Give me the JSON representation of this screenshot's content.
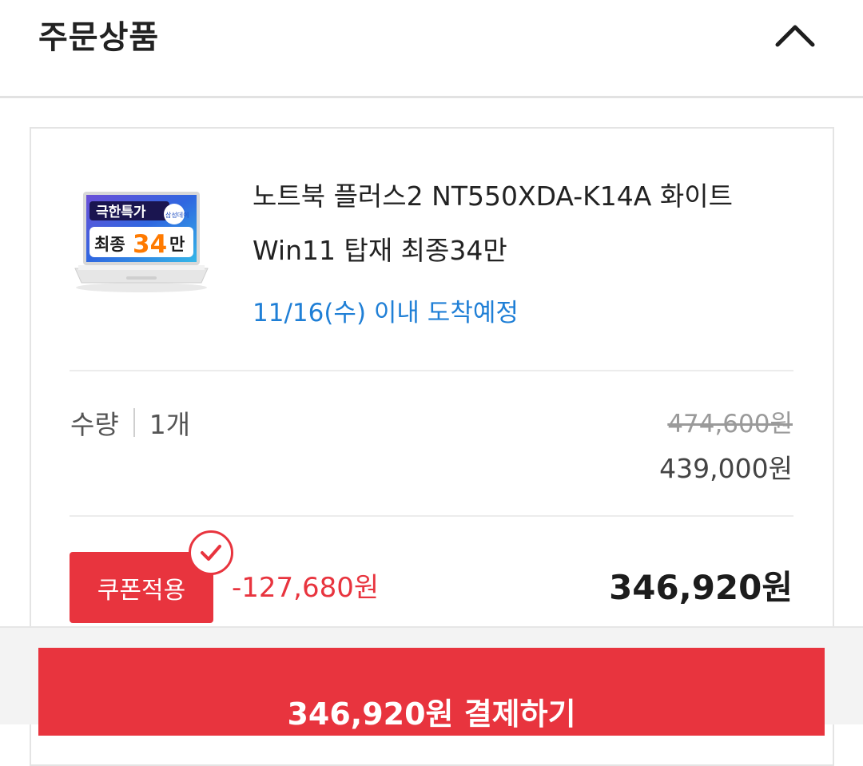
{
  "header": {
    "title": "주문상품"
  },
  "product": {
    "thumbnail_lines": [
      "극한특가",
      "삼성데이",
      "최종",
      "34",
      "만"
    ],
    "name": "노트북 플러스2 NT550XDA-K14A 화이트 Win11 탑재 최종34만",
    "delivery": "11/16(수) 이내 도착예정"
  },
  "quantity": {
    "label": "수량",
    "value": "1개"
  },
  "price": {
    "original": "474,600원",
    "sale": "439,000원"
  },
  "coupon": {
    "label": "쿠폰적용",
    "discount": "-127,680원"
  },
  "total": {
    "final_price": "346,920원"
  },
  "pay_button": {
    "label": "346,920원 결제하기"
  },
  "colors": {
    "accent_red": "#e8343e",
    "link_blue": "#1f7fd6"
  },
  "icons": {
    "collapse": "chevron-up-icon",
    "coupon_check": "check-circle-icon"
  }
}
